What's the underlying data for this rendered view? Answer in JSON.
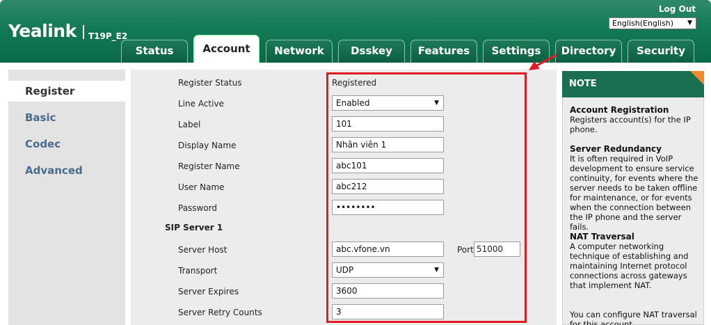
{
  "header": {
    "logo": "Yealink",
    "model": "T19P_E2",
    "logout": "Log Out",
    "language": "English(English)"
  },
  "tabs": [
    {
      "label": "Status"
    },
    {
      "label": "Account"
    },
    {
      "label": "Network"
    },
    {
      "label": "Dsskey"
    },
    {
      "label": "Features"
    },
    {
      "label": "Settings"
    },
    {
      "label": "Directory"
    },
    {
      "label": "Security"
    }
  ],
  "sidebar": {
    "items": [
      {
        "label": "Register"
      },
      {
        "label": "Basic"
      },
      {
        "label": "Codec"
      },
      {
        "label": "Advanced"
      }
    ]
  },
  "form": {
    "register_status": {
      "label": "Register Status",
      "value": "Registered"
    },
    "line_active": {
      "label": "Line Active",
      "value": "Enabled"
    },
    "label": {
      "label": "Label",
      "value": "101"
    },
    "display_name": {
      "label": "Display Name",
      "value": "Nhân viên 1"
    },
    "register_name": {
      "label": "Register Name",
      "value": "abc101"
    },
    "user_name": {
      "label": "User Name",
      "value": "abc212"
    },
    "password": {
      "label": "Password",
      "value": "••••••••"
    },
    "sip_server_title": "SIP Server 1",
    "server_host": {
      "label": "Server Host",
      "value": "abc.vfone.vn"
    },
    "port": {
      "label": "Port",
      "value": "51000"
    },
    "transport": {
      "label": "Transport",
      "value": "UDP"
    },
    "server_expires": {
      "label": "Server Expires",
      "value": "3600"
    },
    "server_retry": {
      "label": "Server Retry Counts",
      "value": "3"
    }
  },
  "note": {
    "header": "NOTE",
    "sections": [
      {
        "title": "Account Registration",
        "body": "Registers account(s) for the IP phone."
      },
      {
        "title": "Server Redundancy",
        "body": "It is often required in VoIP development to ensure service continuity, for events where the server needs to be taken offline for maintenance, or for events when the connection between the IP phone and the server fails."
      },
      {
        "title": "NAT Traversal",
        "body": "A computer networking technique of establishing and maintaining Internet protocol connections across gateways that implement NAT."
      }
    ],
    "footer": "You can configure NAT traversal for this account."
  },
  "colors": {
    "brand_green": "#137a55",
    "annotation_red": "#e11b22",
    "note_corner": "#f08a2a"
  }
}
